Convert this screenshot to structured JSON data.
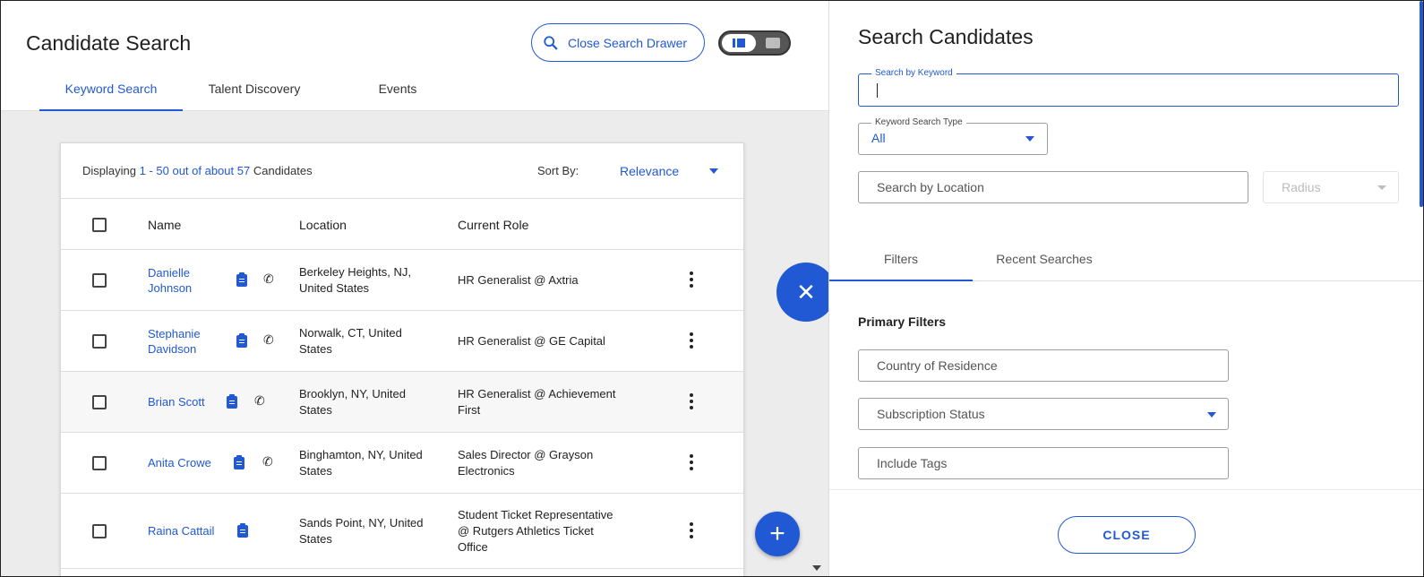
{
  "header": {
    "title": "Candidate Search",
    "close_drawer_label": "Close Search Drawer",
    "tabs": [
      {
        "label": "Keyword Search",
        "active": true
      },
      {
        "label": "Talent Discovery",
        "active": false
      },
      {
        "label": "Events",
        "active": false
      }
    ]
  },
  "results": {
    "displaying_prefix": "Displaying",
    "displaying_range": "1 - 50 out of about 57",
    "displaying_suffix": "Candidates",
    "sort_label": "Sort By:",
    "sort_value": "Relevance",
    "columns": {
      "name": "Name",
      "location": "Location",
      "role": "Current Role"
    },
    "rows": [
      {
        "name_line1": "Danielle",
        "name_line2": "Johnson",
        "location_line1": "Berkeley Heights, NJ,",
        "location_line2": "United States",
        "role_line1": "HR Generalist @ Axtria",
        "role_line2": "",
        "role_line3": "",
        "has_phone": true
      },
      {
        "name_line1": "Stephanie",
        "name_line2": "Davidson",
        "location_line1": "Norwalk, CT, United",
        "location_line2": "States",
        "role_line1": "HR Generalist @ GE Capital",
        "role_line2": "",
        "role_line3": "",
        "has_phone": true
      },
      {
        "name_line1": "Brian Scott",
        "name_line2": "",
        "location_line1": "Brooklyn, NY, United",
        "location_line2": "States",
        "role_line1": "HR Generalist @ Achievement",
        "role_line2": "First",
        "role_line3": "",
        "has_phone": true
      },
      {
        "name_line1": "Anita Crowe",
        "name_line2": "",
        "location_line1": "Binghamton, NY, United",
        "location_line2": "States",
        "role_line1": "Sales Director @ Grayson",
        "role_line2": "Electronics",
        "role_line3": "",
        "has_phone": true
      },
      {
        "name_line1": "Raina Cattail",
        "name_line2": "",
        "location_line1": "Sands Point, NY, United",
        "location_line2": "States",
        "role_line1": "Student Ticket Representative",
        "role_line2": "@ Rutgers Athletics Ticket",
        "role_line3": "Office",
        "has_phone": false
      }
    ]
  },
  "drawer": {
    "title": "Search Candidates",
    "keyword_label": "Search by Keyword",
    "keyword_value": "",
    "keyword_type_label": "Keyword Search Type",
    "keyword_type_value": "All",
    "location_placeholder": "Search by Location",
    "radius_placeholder": "Radius",
    "tabs": [
      {
        "label": "Filters",
        "active": true
      },
      {
        "label": "Recent Searches",
        "active": false
      }
    ],
    "primary_filters_title": "Primary Filters",
    "country_placeholder": "Country of Residence",
    "subscription_placeholder": "Subscription Status",
    "tags_placeholder": "Include Tags",
    "close_label": "CLOSE"
  },
  "colors": {
    "accent": "#2159d4"
  },
  "icons": [
    "search-icon",
    "clipboard-icon",
    "phone-icon",
    "more-vert-icon",
    "close-icon",
    "add-icon",
    "chevron-down-icon",
    "view-toggle-icon"
  ]
}
